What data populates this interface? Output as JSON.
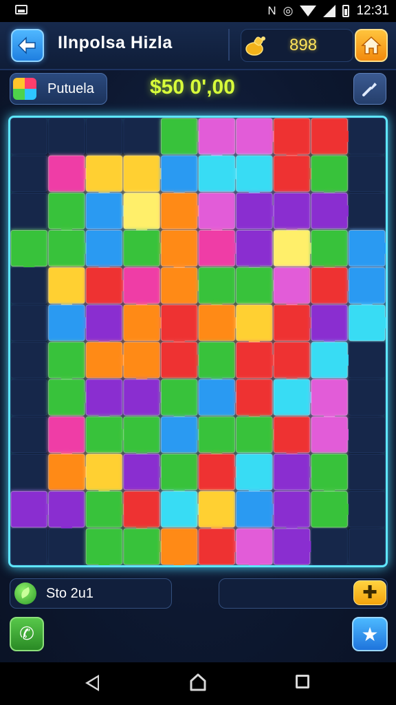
{
  "status_bar": {
    "time": "12:31",
    "icons": [
      "notification-icon",
      "nfc-icon",
      "alarm-icon",
      "wifi-icon",
      "cell-signal-icon",
      "battery-icon"
    ]
  },
  "header": {
    "title": "Ilnpolsa Hizla",
    "coins": "898",
    "back_icon": "arrow-left-icon",
    "home_icon": "home-icon",
    "coin_icon": "coin-bag-icon"
  },
  "sub_header": {
    "puzzle_label": "Putuela",
    "score": "$50 0',00",
    "tool_icon": "wrench-icon"
  },
  "board": {
    "cols": 10,
    "rows": 12,
    "colors": {
      "G": "#39c23a",
      "B": "#2a9af2",
      "C": "#39dcf4",
      "Y": "#ffd032",
      "O": "#ff8a18",
      "R": "#ee3232",
      "P": "#ef3ea6",
      "U": "#8a2ed0",
      "M": "#e25cd8",
      "L": "#ffef6a",
      "D": "#16274a"
    },
    "grid": [
      "DDDDGMMRRD",
      "DPYYBCCRGD",
      "DGBLOMUUUD",
      "GGBGOPULGB",
      "DYRPOGGMRB",
      "DBUOROYRUC",
      "DGOORGRRCD",
      "DGUUGBRCMD",
      "DPGGBGGRMD",
      "DOYUGRCUGD",
      "UUGRCYBUGD",
      "DDGGORMUDD"
    ]
  },
  "footer": {
    "status_text": "Sto 2u1",
    "leaf_icon": "leaf-icon",
    "add_icon": "plus-icon",
    "phone_icon": "phone-icon",
    "star_icon": "star-icon"
  },
  "nav": {
    "back_icon": "nav-back-icon",
    "home_icon": "nav-home-icon",
    "recents_icon": "nav-recents-icon"
  }
}
